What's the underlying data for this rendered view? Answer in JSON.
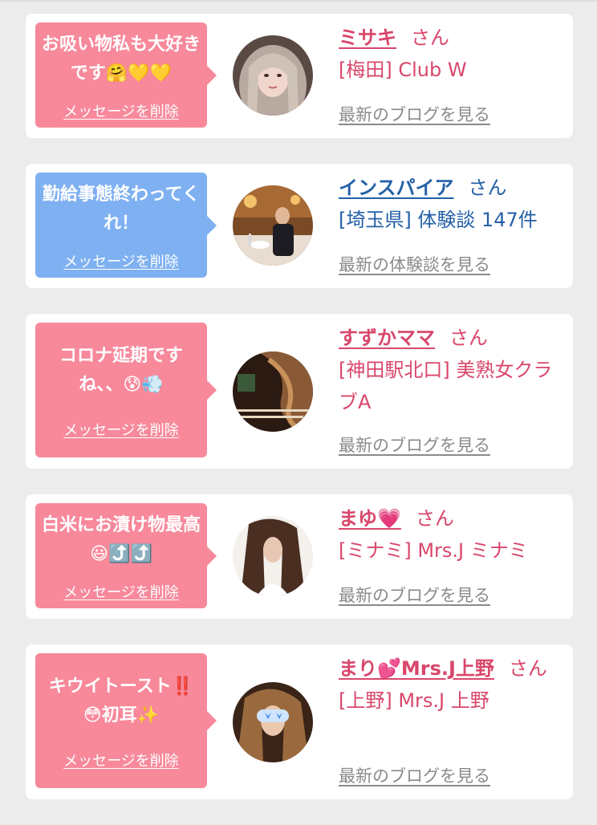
{
  "colors": {
    "background": "#ececec",
    "card": "#ffffff",
    "pink_bubble": "#f7899b",
    "blue_bubble": "#7eb0f2",
    "pink_text": "#d9476b",
    "blue_text": "#2460a7",
    "link_gray": "#8a8a8a"
  },
  "cards": [
    {
      "theme": "pink",
      "message": "お吸い物私も大好きです🤗💛💛",
      "delete_label": "メッセージを削除",
      "name": "ミサキ",
      "honorific": "さん",
      "shop": "[梅田] Club W",
      "blog_link": "最新のブログを見る",
      "avatar_icon": "woman-portrait-icon"
    },
    {
      "theme": "blue",
      "message": "勤給事態終わってくれ！",
      "delete_label": "メッセージを削除",
      "name": "インスパイア",
      "honorific": "さん",
      "shop": "[埼玉県] 体験談 147件",
      "blog_link": "最新の体験談を見る",
      "avatar_icon": "man-restaurant-photo-icon"
    },
    {
      "theme": "pink",
      "message": "コロナ延期ですね、、😰💨",
      "delete_label": "メッセージを削除",
      "name": "すずかママ",
      "honorific": "さん",
      "shop": "[神田駅北口] 美熟女クラブA",
      "blog_link": "最新のブログを見る",
      "avatar_icon": "club-flyer-icon"
    },
    {
      "theme": "pink",
      "message": "白米にお漬け物最高😃⤴️⤴️",
      "delete_label": "メッセージを削除",
      "name": "まゆ💗",
      "honorific": "さん",
      "shop": "[ミナミ] Mrs.J ミナミ",
      "blog_link": "最新のブログを見る",
      "avatar_icon": "woman-long-hair-icon"
    },
    {
      "theme": "pink",
      "message": "キウイトースト‼️😳初耳✨",
      "delete_label": "メッセージを削除",
      "name": "まり💕Mrs.J上野",
      "honorific": "さん",
      "shop": "[上野] Mrs.J 上野",
      "blog_link": "最新のブログを見る",
      "avatar_icon": "woman-heart-eyes-sticker-icon"
    }
  ]
}
